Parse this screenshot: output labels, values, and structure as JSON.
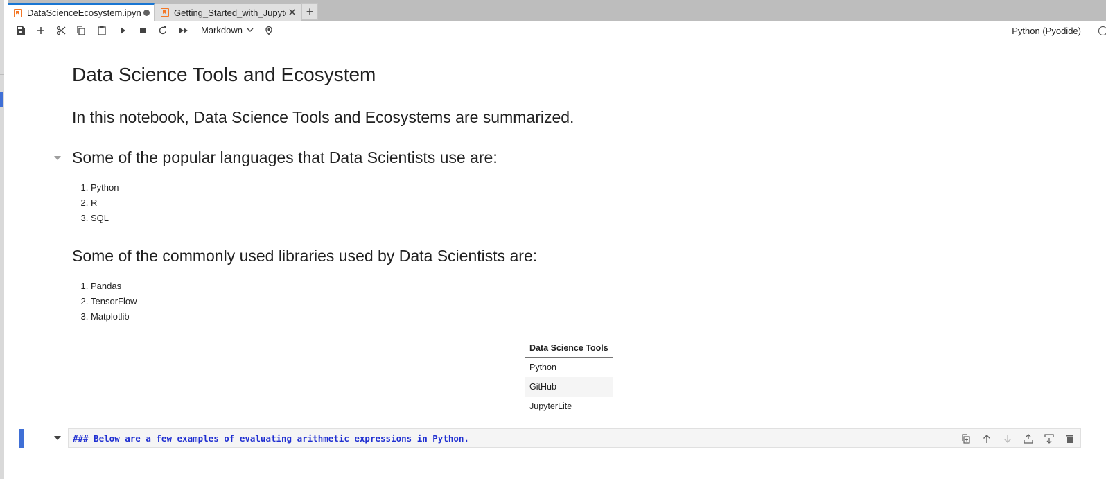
{
  "tabs": [
    {
      "label": "DataScienceEcosystem.ipynb",
      "dirty": true,
      "active": true
    },
    {
      "label": "Getting_Started_with_Jupyter",
      "dirty": false,
      "active": false
    }
  ],
  "toolbar": {
    "cell_type": "Markdown",
    "kernel": "Python (Pyodide)",
    "icons": [
      "save-icon",
      "add-icon",
      "cut-icon",
      "copy-icon",
      "paste-icon",
      "run-icon",
      "stop-icon",
      "restart-icon",
      "run-all-icon",
      "bug-icon"
    ]
  },
  "notebook": {
    "title": "Data Science Tools and Ecosystem",
    "intro": "In this notebook, Data Science Tools and Ecosystems are summarized.",
    "languages_heading": "Some of the popular languages that Data Scientists use are:",
    "languages": [
      "Python",
      "R",
      "SQL"
    ],
    "libraries_heading": "Some of the commonly used libraries used by Data Scientists are:",
    "libraries": [
      "Pandas",
      "TensorFlow",
      "Matplotlib"
    ],
    "tools_table": {
      "header": "Data Science Tools",
      "rows": [
        "Python",
        "GitHub",
        "JupyterLite"
      ]
    },
    "active_cell_source": "### Below are a few examples of evaluating arithmetic expressions in Python."
  },
  "colors": {
    "accent": "#1976d2",
    "active_cell": "#3f6fd6",
    "notebook_icon": "#f37726",
    "markdown_source": "#1f2fd1"
  }
}
